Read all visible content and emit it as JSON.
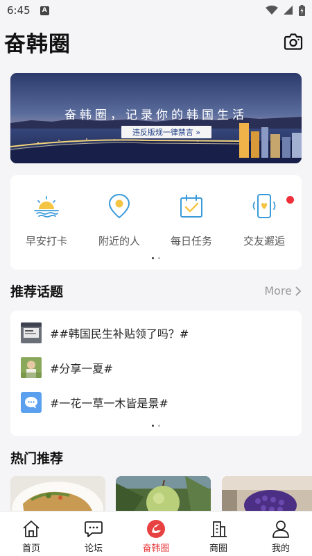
{
  "status_bar": {
    "time": "6:45",
    "notif_letter": "A"
  },
  "header": {
    "title": "奋韩圈",
    "camera_icon": "camera-icon"
  },
  "banner": {
    "title": "奋韩圈，记录你的韩国生活",
    "tag": "违反版规一律禁言 »"
  },
  "quick_actions": {
    "items": [
      {
        "label": "早安打卡",
        "icon": "sunrise-icon"
      },
      {
        "label": "附近的人",
        "icon": "location-pin-icon"
      },
      {
        "label": "每日任务",
        "icon": "calendar-check-icon"
      },
      {
        "label": "交友邂逅",
        "icon": "phone-heart-icon"
      }
    ]
  },
  "topics": {
    "title": "推荐话题",
    "more_label": "More",
    "items": [
      {
        "text": "##韩国民生补贴领了吗？#"
      },
      {
        "text": "#分享一夏#"
      },
      {
        "text": "#一花一草一木皆是景#"
      }
    ]
  },
  "hot": {
    "title": "热门推荐"
  },
  "tab_bar": {
    "items": [
      {
        "label": "首页",
        "icon": "home-icon"
      },
      {
        "label": "论坛",
        "icon": "chat-bubble-icon"
      },
      {
        "label": "奋韩圈",
        "icon": "fenhan-circle-icon",
        "active": true
      },
      {
        "label": "商圈",
        "icon": "building-icon"
      },
      {
        "label": "我的",
        "icon": "person-icon"
      }
    ]
  },
  "colors": {
    "accent": "#e84142",
    "icon_blue": "#3a9bd9",
    "icon_yellow": "#f4c443"
  }
}
